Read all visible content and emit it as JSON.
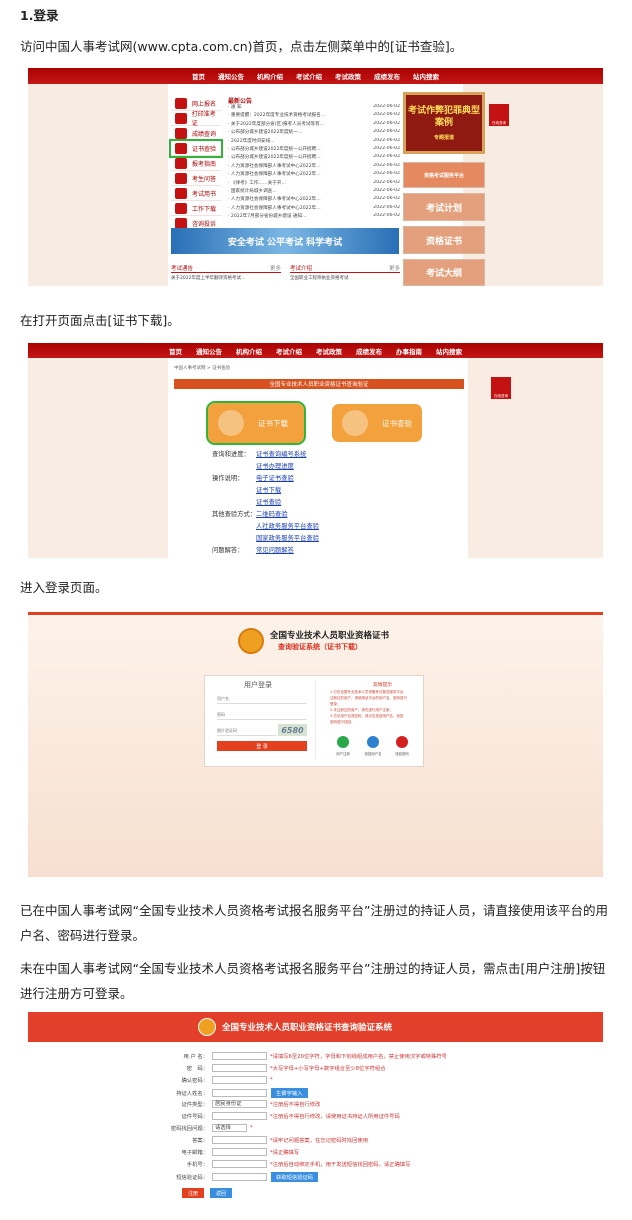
{
  "heading": "1.登录",
  "para1": "访问中国人事考试网(www.cpta.com.cn)首页，点击左侧菜单中的[证书查验]。",
  "para2": "在打开页面点击[证书下载]。",
  "para3": "进入登录页面。",
  "para4": "已在中国人事考试网“全国专业技术人员资格考试报名服务平台”注册过的持证人员，请直接使用该平台的用户名、密码进行登录。",
  "para5": "未在中国人事考试网“全国专业技术人员资格考试报名服务平台”注册过的持证人员，需点击[用户注册]按钮进行注册方可登录。",
  "shot1": {
    "nav": [
      "首页",
      "通知公告",
      "机构介绍",
      "考试介绍",
      "考试政策",
      "成绩发布",
      "站内搜索"
    ],
    "menu": [
      "网上报名",
      "打印准考证",
      "成绩查询",
      "证书查验",
      "报考指南",
      "考生问答",
      "考试用书",
      "工作下载",
      "咨询投诉"
    ],
    "news_title": "最新公告",
    "news": [
      "· 通 知",
      "· 重要提醒：2022年度专业技术资格考试报名…",
      "· 关于2022年度部分省(区)报考人员考试等有…",
      "· 公布部分城乡建设2022年度统一…",
      "· 2022年度时间安排…",
      "· 公布部分城乡建设2022年度统一公开招聘…",
      "· 公布部分城乡建设2022年度统一公开招聘…",
      "· 人力资源社会保障部人事考试中心2022年…",
      "· 人力资源社会保障部人事考试中心2022年…",
      "· 《律考》工作……关于开…",
      "· 国家统计局城乡调查…",
      "· 人力资源社会保障部人事考试中心2022年…",
      "· 人力资源社会保障部人事考试中心2022年…",
      "· 2022年7月部分省份城乡建设 通知…"
    ],
    "news_date": "2022-06-02",
    "banner": "安全考试 公平考试 科学考试",
    "bottom_left": "考试通告",
    "bottom_right": "考试介绍",
    "more": "更多",
    "bottom_left_item": "关于2022年度上半年翻译资格考试…",
    "bottom_right_item": "全国职业工程师执业资格考试",
    "ad1": "考试作弊犯罪典型案例",
    "ad1_sub": "专题报道",
    "ad2": "资格考试服务平台",
    "ad3": "考试计划",
    "ad4": "资格证书",
    "ad5": "考试大纲",
    "float_label": "在线咨询"
  },
  "shot2": {
    "nav": [
      "首页",
      "通知公告",
      "机构介绍",
      "考试介绍",
      "考试政策",
      "成绩发布",
      "办事指南",
      "站内搜索"
    ],
    "breadcrumb": "中国人事考试网 > 证书查验",
    "header": "全国专业技术人员职业资格证书查询验证",
    "btn_download": "证书下载",
    "btn_verify": "证书查验",
    "rows": [
      {
        "label": "查询和进度：",
        "links": [
          "证书查询编号系统",
          "证书办理进度"
        ]
      },
      {
        "label": "操作说明：",
        "links": [
          "电子证书查验"
        ]
      },
      {
        "label": "",
        "links": [
          "证书下载"
        ]
      },
      {
        "label": "",
        "links": [
          "证书查验"
        ]
      },
      {
        "label": "其他查验方式：",
        "links": [
          "二维码查验"
        ]
      },
      {
        "label": "",
        "links": [
          "人社政务服务平台查验"
        ]
      },
      {
        "label": "",
        "links": [
          "国家政务服务平台查验"
        ]
      },
      {
        "label": "问题解答：",
        "links": [
          "常见问题解答"
        ]
      }
    ],
    "float_label": "在线咨询"
  },
  "shot3": {
    "title": "全国专业技术人员职业资格证书",
    "subtitle": "查询验证系统（证书下载）",
    "login_title": "用户登录",
    "username_ph": "用户名",
    "password_ph": "密码",
    "captcha_ph": "图片验证码",
    "captcha": "6580",
    "login_btn": "登 录",
    "tips_title": "友情提示",
    "tips": [
      "1.已在全国专业技术人员资格考试报名服务平台",
      "注册过的用户，请使用该平台的用户名、密码进行",
      "登录；",
      "2.未注册过的用户，请先进行用户注册；",
      "3.忘记用户名或密码，请点击找回用户名、找回",
      "密码进行找回。"
    ],
    "icons": [
      "用户注册",
      "找回用户名",
      "找回密码"
    ]
  },
  "shot4": {
    "title": "全国专业技术人员职业资格证书查询验证系统",
    "fields": [
      {
        "label": "用 户 名：",
        "hint": "*请填写6至20位字符，字母和下划线组成用户名，禁止使用汉字或特殊符号"
      },
      {
        "label": "密　码：",
        "hint": "*大写字母+小写字母+数字组合至少8位字符组合"
      },
      {
        "label": "确认密码：",
        "hint": "*"
      },
      {
        "label": "持证人姓名：",
        "hint": ""
      },
      {
        "label": "证件类型：",
        "hint": "*注册后不得自行修改"
      },
      {
        "label": "证件号码：",
        "hint": "*注册后不得自行修改，请使用证书持证人所用证件号码"
      },
      {
        "label": "密码找回问题：",
        "hint": "*"
      },
      {
        "label": "答案：",
        "hint": "*请牢记问题答案，在忘记密码时找回使用"
      },
      {
        "label": "电子邮箱：",
        "hint": "*请正确填写"
      },
      {
        "label": "手机号：",
        "hint": "*注册后自动绑定手机，用于发送短信找回密码，请正确填写"
      },
      {
        "label": "短信验证码：",
        "hint": ""
      }
    ],
    "name_btn": "生僻字输入",
    "id_type_value": "居民身份证",
    "question_value": "请选择",
    "sms_btn": "获取短信验证码",
    "submit": "注册",
    "back": "返回"
  }
}
